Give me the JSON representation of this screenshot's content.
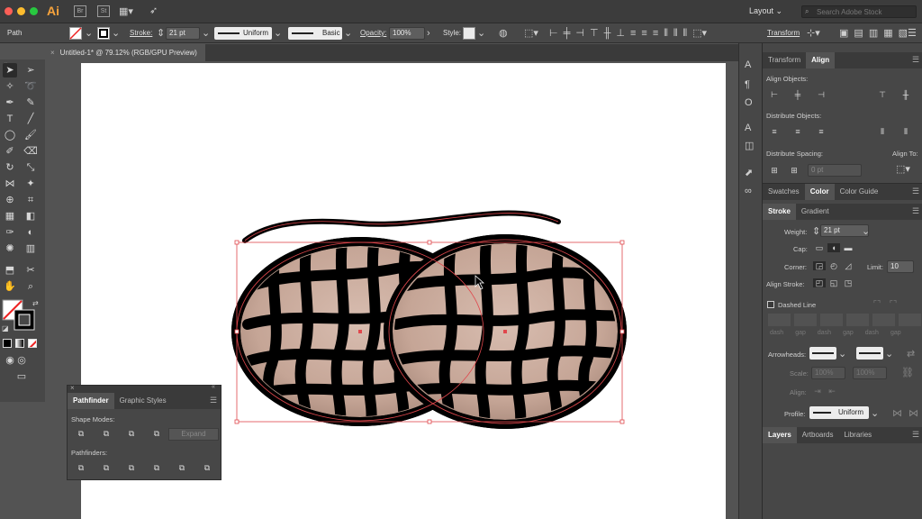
{
  "appbar": {
    "app_logo": "Ai",
    "br_label": "Br",
    "st_label": "St",
    "workspace": "Layout",
    "search_placeholder": "Search Adobe Stock"
  },
  "control_bar": {
    "selection_type": "Path",
    "stroke_label": "Stroke:",
    "stroke_weight": "21 pt",
    "profile": "Uniform",
    "brush": "Basic",
    "opacity_label": "Opacity:",
    "opacity_value": "100%",
    "style_label": "Style:",
    "transform_label": "Transform"
  },
  "document_tab": {
    "title": "Untitled-1* @ 79.12% (RGB/GPU Preview)"
  },
  "align_panel": {
    "tabs": [
      "Transform",
      "Align"
    ],
    "active_tab": "Align",
    "align_objects_label": "Align Objects:",
    "distribute_objects_label": "Distribute Objects:",
    "distribute_spacing_label": "Distribute Spacing:",
    "align_to_label": "Align To:",
    "spacing_value": "0 pt"
  },
  "color_panel": {
    "tabs": [
      "Swatches",
      "Color",
      "Color Guide"
    ],
    "active_tab": "Color"
  },
  "stroke_panel": {
    "tabs": [
      "Stroke",
      "Gradient"
    ],
    "active_tab": "Stroke",
    "weight_label": "Weight:",
    "weight_value": "21 pt",
    "cap_label": "Cap:",
    "corner_label": "Corner:",
    "limit_label": "Limit:",
    "limit_value": "10",
    "align_stroke_label": "Align Stroke:",
    "dashed_line_label": "Dashed Line",
    "dash_labels": [
      "dash",
      "gap",
      "dash",
      "gap",
      "dash",
      "gap"
    ],
    "arrowheads_label": "Arrowheads:",
    "scale_label": "Scale:",
    "scale_values": [
      "100%",
      "100%"
    ],
    "align_label": "Align:",
    "profile_label": "Profile:",
    "profile_value": "Uniform"
  },
  "layers_panel": {
    "tabs": [
      "Layers",
      "Artboards",
      "Libraries"
    ],
    "active_tab": "Layers"
  },
  "pathfinder_panel": {
    "tabs": [
      "Pathfinder",
      "Graphic Styles"
    ],
    "active_tab": "Pathfinder",
    "shape_modes_label": "Shape Modes:",
    "expand_label": "Expand",
    "pathfinders_label": "Pathfinders:"
  },
  "colors": {
    "chrome_dark": "#3c3c3c",
    "panel": "#474747",
    "selection": "#e0474c",
    "peanut_shell": "#c9a89a"
  }
}
